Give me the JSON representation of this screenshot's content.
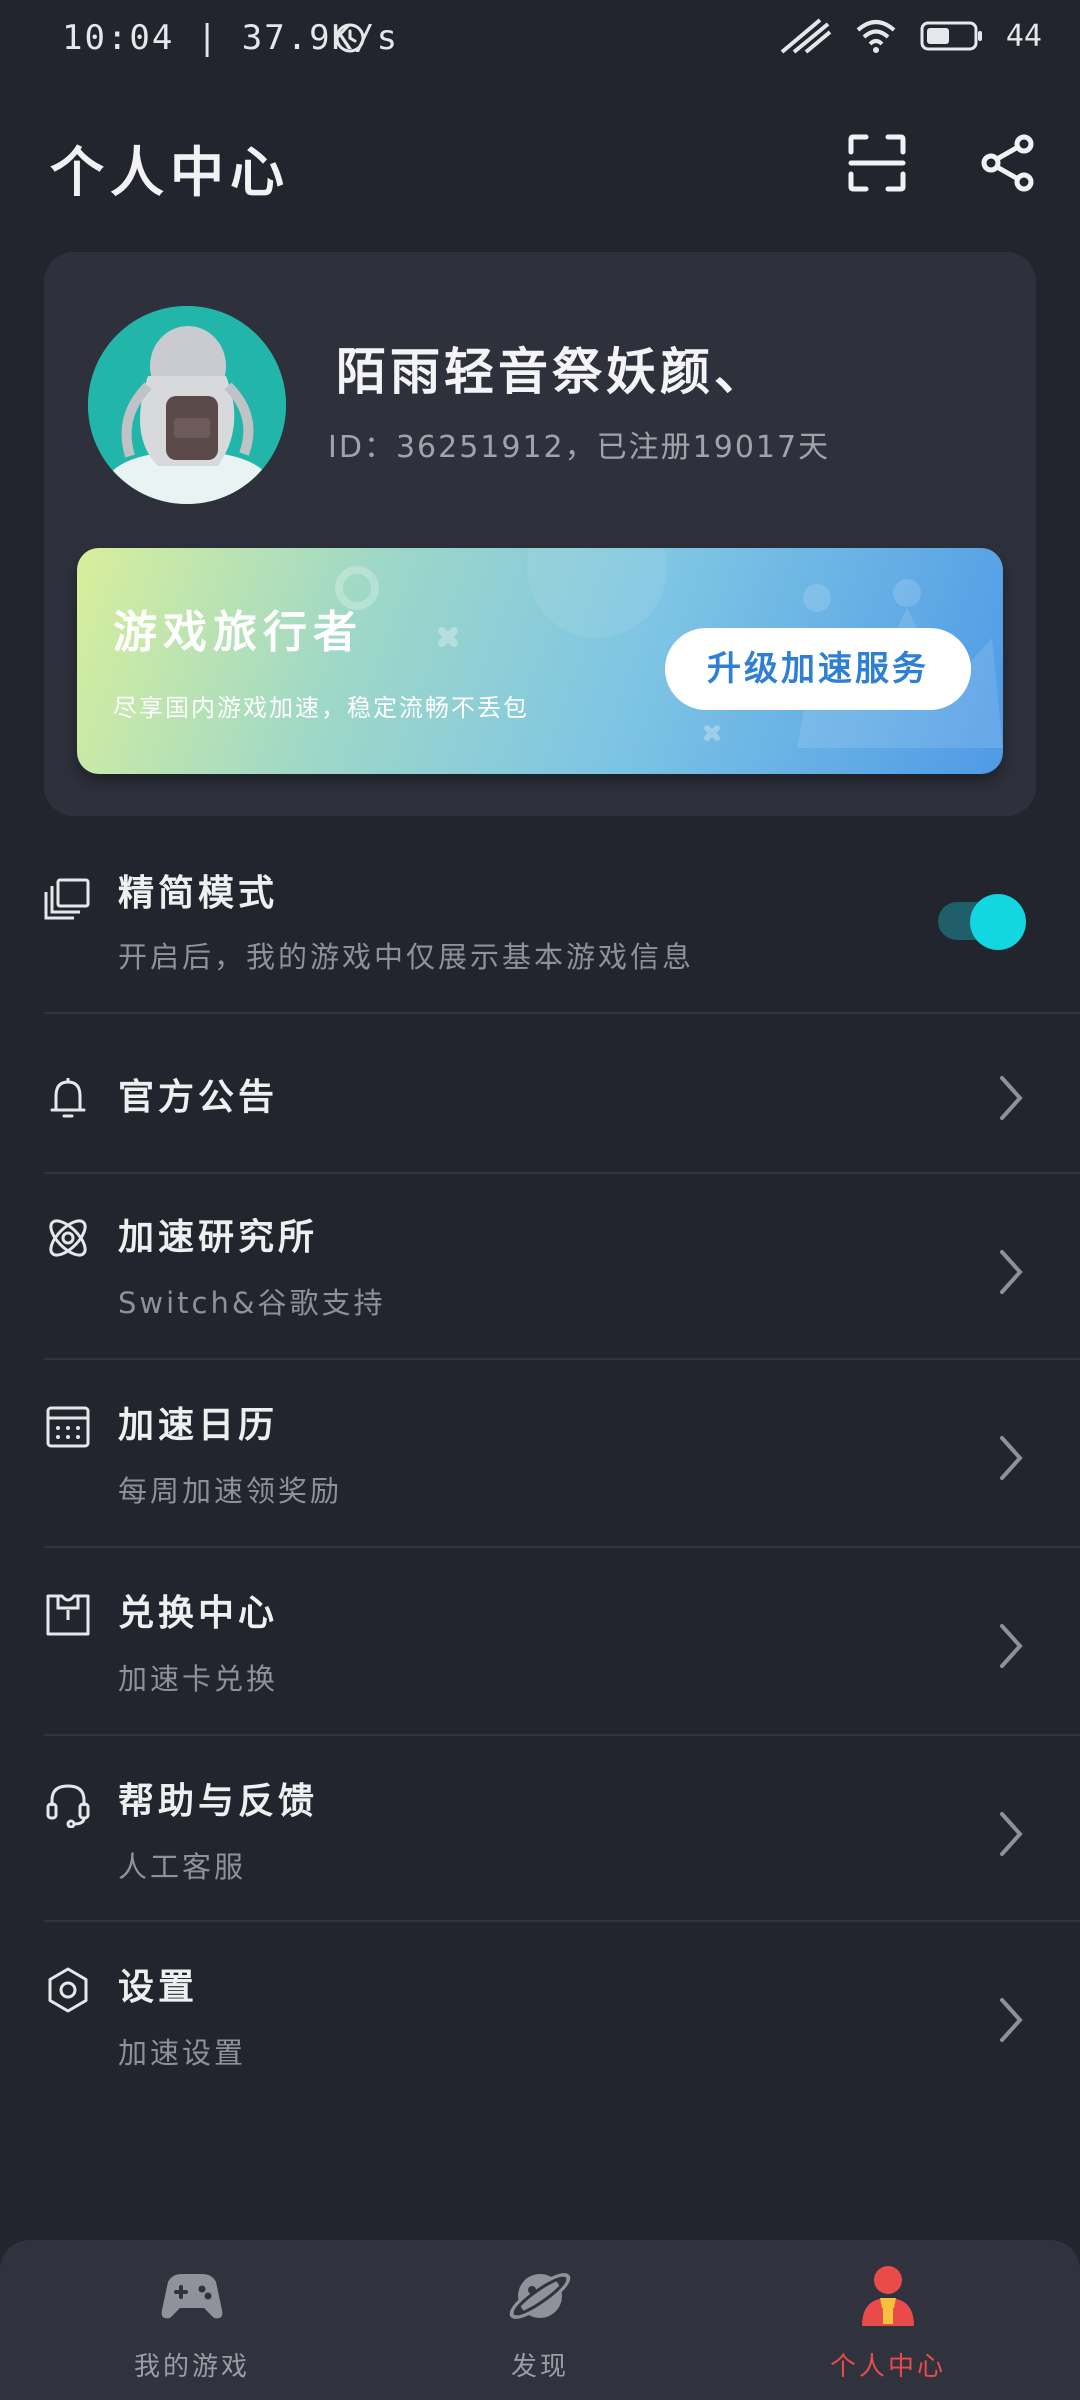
{
  "status_bar": {
    "time_speed": "10:04 | 37.9K/s",
    "battery": "44",
    "icons": [
      "alarm-clock-icon",
      "signal-icon",
      "wifi-icon",
      "battery-icon"
    ]
  },
  "header": {
    "title": "个人中心",
    "icons": [
      "scan-icon",
      "share-icon"
    ]
  },
  "profile": {
    "username": "陌雨轻音祭妖颜、",
    "id_line": "ID：36251912，已注册19017天"
  },
  "vip_banner": {
    "title": "游戏旅行者",
    "subtitle": "尽享国内游戏加速，稳定流畅不丢包",
    "button": "升级加速服务"
  },
  "menu": {
    "simple_mode": {
      "label": "精简模式",
      "sub": "开启后，我的游戏中仅展示基本游戏信息",
      "toggle_on": true,
      "icon": "layers-icon"
    },
    "items": [
      {
        "label": "官方公告",
        "sub": "",
        "icon": "bell-icon"
      },
      {
        "label": "加速研究所",
        "sub": "Switch&谷歌支持",
        "icon": "atom-icon"
      },
      {
        "label": "加速日历",
        "sub": "每周加速领奖励",
        "icon": "calendar-icon"
      },
      {
        "label": "兑换中心",
        "sub": "加速卡兑换",
        "icon": "shirt-icon"
      },
      {
        "label": "帮助与反馈",
        "sub": "人工客服",
        "icon": "headset-icon"
      },
      {
        "label": "设置",
        "sub": "加速设置",
        "icon": "settings-icon"
      }
    ]
  },
  "bottom_nav": {
    "items": [
      {
        "label": "我的游戏",
        "icon": "gamepad-icon",
        "active": false
      },
      {
        "label": "发现",
        "icon": "planet-icon",
        "active": false
      },
      {
        "label": "个人中心",
        "icon": "user-icon",
        "active": true
      }
    ],
    "active_color": "#e94b4b"
  },
  "colors": {
    "background": "#22252e",
    "card": "#2e313c",
    "toggle_accent": "#12d6e0",
    "vip_button_text": "#2f7fd6"
  }
}
